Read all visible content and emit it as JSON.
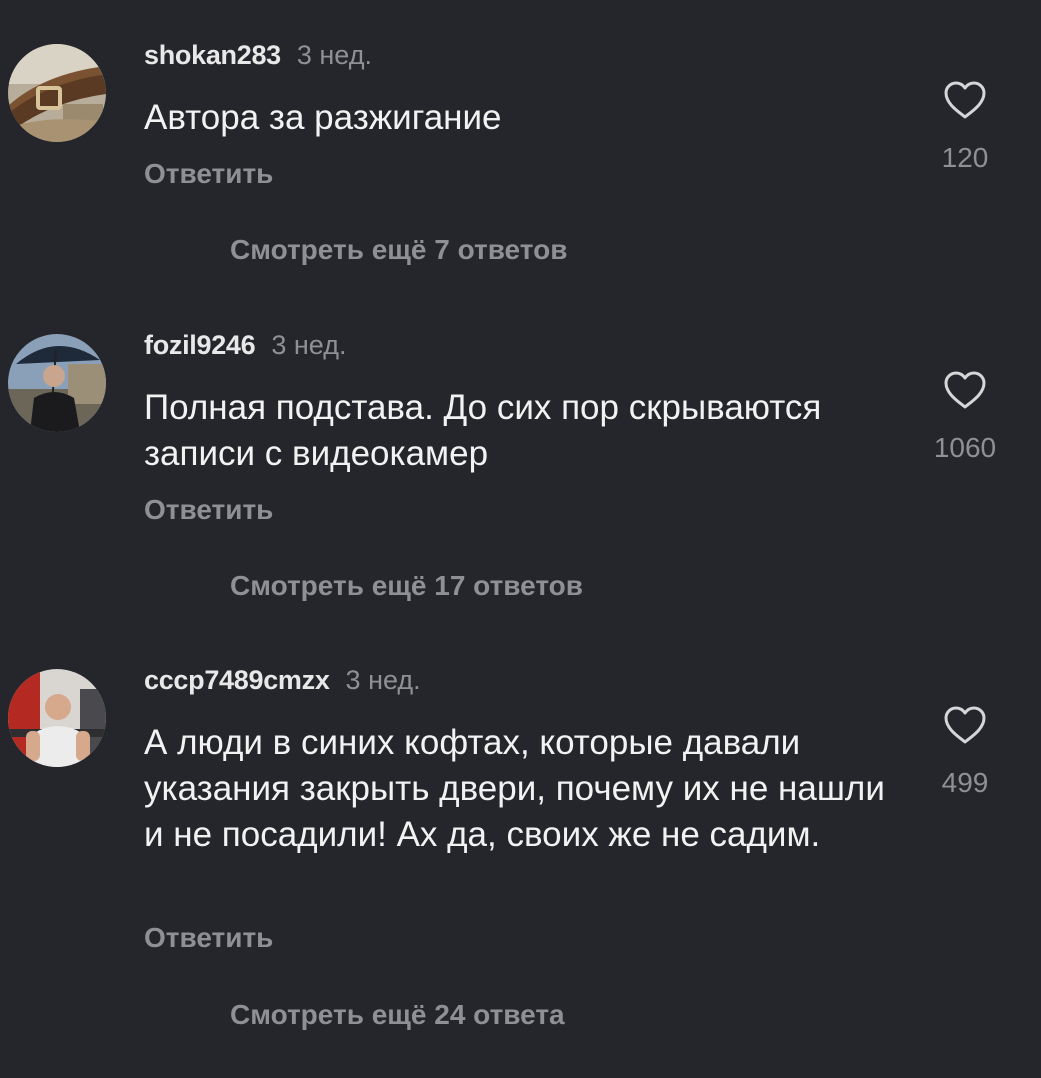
{
  "comments": [
    {
      "username": "shokan283",
      "time": "3 нед.",
      "text": "Автора за разжигание",
      "likes": "120",
      "reply_label": "Ответить",
      "more_label": "Смотреть ещё 7 ответов",
      "avatar_icon": "belt-photo-avatar"
    },
    {
      "username": "fozil9246",
      "time": "3 нед.",
      "text": "Полная подстава. До сих пор скрываются записи с видеокамер",
      "likes": "1060",
      "reply_label": "Ответить",
      "more_label": "Смотреть ещё 17 ответов",
      "avatar_icon": "man-with-umbrella-avatar"
    },
    {
      "username": "cccp7489cmzx",
      "time": "3 нед.",
      "text": "А люди в синих кофтах, которые давали указания закрыть двери, почему их не нашли и не посадили! Ах да, своих же не садим.",
      "likes": "499",
      "reply_label": "Ответить",
      "more_label": "Смотреть ещё 24 ответа",
      "avatar_icon": "man-in-gym-avatar"
    }
  ],
  "colors": {
    "background": "#24262b",
    "primary_text": "#f2f2f2",
    "secondary_text": "#8e9096"
  },
  "icons": {
    "like": "heart-outline-icon"
  }
}
